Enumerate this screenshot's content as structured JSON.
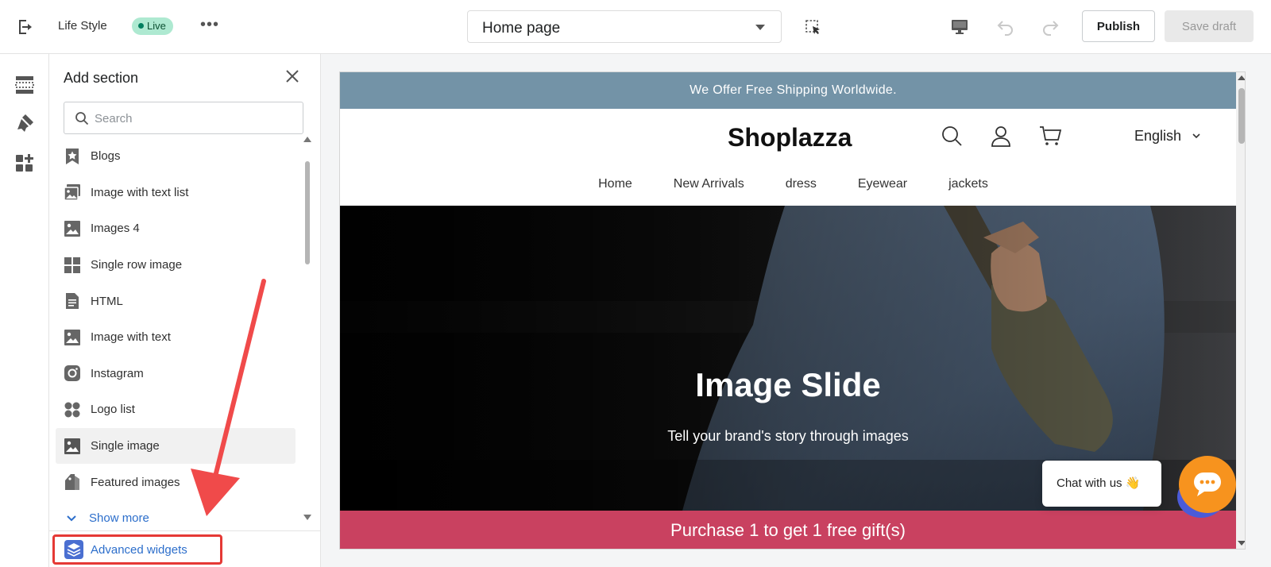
{
  "topbar": {
    "store_name": "Life Style",
    "status_badge": "Live",
    "more_label": "•••",
    "page_select": "Home page",
    "publish_label": "Publish",
    "save_draft_label": "Save draft"
  },
  "panel": {
    "title": "Add section",
    "search_placeholder": "Search",
    "items": [
      {
        "label": "Blogs",
        "icon": "star-bookmark-icon"
      },
      {
        "label": "Image with text list",
        "icon": "image-list-icon"
      },
      {
        "label": "Images 4",
        "icon": "image-icon"
      },
      {
        "label": "Single row image",
        "icon": "grid-icon"
      },
      {
        "label": "HTML",
        "icon": "document-icon"
      },
      {
        "label": "Image with text",
        "icon": "image-icon"
      },
      {
        "label": "Instagram",
        "icon": "instagram-icon"
      },
      {
        "label": "Logo list",
        "icon": "logo-grid-icon"
      },
      {
        "label": "Single image",
        "icon": "image-icon"
      },
      {
        "label": "Featured images",
        "icon": "tag-icon"
      }
    ],
    "show_more": "Show more",
    "advanced_widgets": "Advanced widgets"
  },
  "preview": {
    "announcement": "We Offer Free Shipping Worldwide.",
    "logo": "Shoplazza",
    "language": "English",
    "nav": [
      "Home",
      "New Arrivals",
      "dress",
      "Eyewear",
      "jackets"
    ],
    "hero_title": "Image Slide",
    "hero_subtitle": "Tell your brand's story through images",
    "promo": "Purchase 1 to get 1 free gift(s)"
  },
  "chat": {
    "label": "Chat with us 👋"
  },
  "colors": {
    "accent_blue": "#2c6ecb",
    "announcement_bg": "#7393a7",
    "promo_bg": "#c94160",
    "chat_orange": "#f7931e",
    "highlight_red": "#e53935"
  }
}
